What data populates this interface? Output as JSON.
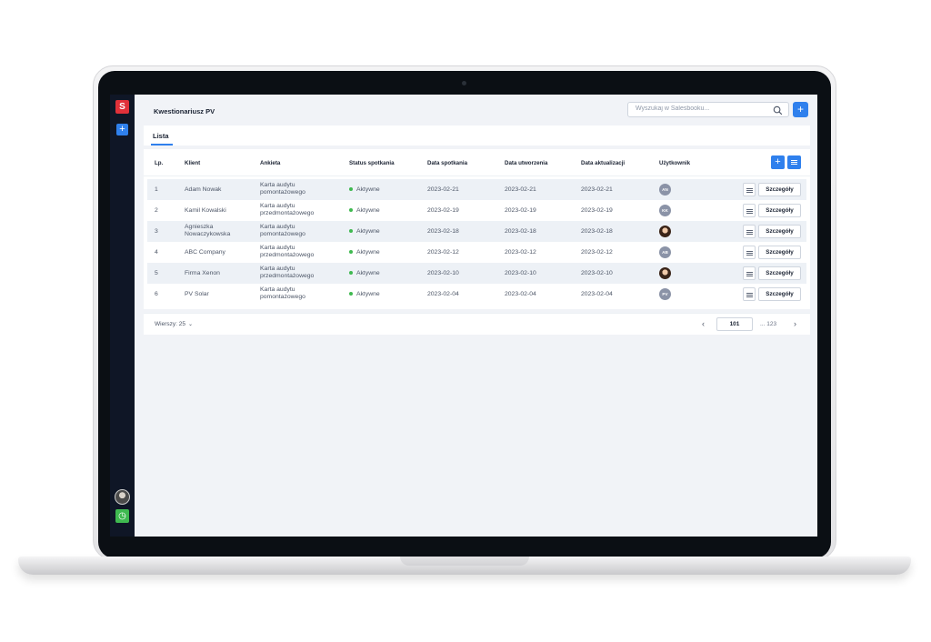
{
  "app": {
    "logo": "S",
    "title": "Kwestionariusz PV"
  },
  "search": {
    "placeholder": "Wyszukaj w Salesbooku..."
  },
  "tabs": [
    {
      "label": "Lista"
    }
  ],
  "table": {
    "headers": [
      "Lp.",
      "Klient",
      "Ankieta",
      "Status spotkania",
      "Data spotkania",
      "Data utworzenia",
      "Data aktualizacji",
      "Użytkownik"
    ],
    "rows": [
      {
        "lp": "1",
        "client": "Adam Nowak",
        "survey": "Karta audytu pomontażowego",
        "status": "Aktywne",
        "meeting": "2023-02-21",
        "created": "2023-02-21",
        "updated": "2023-02-21",
        "user": "AN",
        "details": "Szczegóły"
      },
      {
        "lp": "2",
        "client": "Kamil Kowalski",
        "survey": "Karta audytu przedmontażowego",
        "status": "Aktywne",
        "meeting": "2023-02-19",
        "created": "2023-02-19",
        "updated": "2023-02-19",
        "user": "KK",
        "details": "Szczegóły"
      },
      {
        "lp": "3",
        "client": "Agnieszka Nowaczykowska",
        "survey": "Karta audytu pomontażowego",
        "status": "Aktywne",
        "meeting": "2023-02-18",
        "created": "2023-02-18",
        "updated": "2023-02-18",
        "user": "",
        "details": "Szczegóły"
      },
      {
        "lp": "4",
        "client": "ABC Company",
        "survey": "Karta audytu przedmontażowego",
        "status": "Aktywne",
        "meeting": "2023-02-12",
        "created": "2023-02-12",
        "updated": "2023-02-12",
        "user": "AB",
        "details": "Szczegóły"
      },
      {
        "lp": "5",
        "client": "Firma Xenon",
        "survey": "Karta audytu przedmontażowego",
        "status": "Aktywne",
        "meeting": "2023-02-10",
        "created": "2023-02-10",
        "updated": "2023-02-10",
        "user": "",
        "details": "Szczegóły"
      },
      {
        "lp": "6",
        "client": "PV Solar",
        "survey": "Karta audytu pomontażowego",
        "status": "Aktywne",
        "meeting": "2023-02-04",
        "created": "2023-02-04",
        "updated": "2023-02-04",
        "user": "PV",
        "details": "Szczegóły"
      }
    ]
  },
  "pagination": {
    "rows_label": "Wierszy: 25",
    "current_page": "101",
    "last_page": "... 123"
  },
  "colors": {
    "accent": "#2f80ed",
    "active": "#3fb950",
    "sidebar": "#0f1626",
    "logo": "#e0313a"
  },
  "icons": [
    "search-icon",
    "plus-icon",
    "menu-icon",
    "clock-icon",
    "chevron-down-icon",
    "chevron-left-icon",
    "chevron-right-icon"
  ]
}
